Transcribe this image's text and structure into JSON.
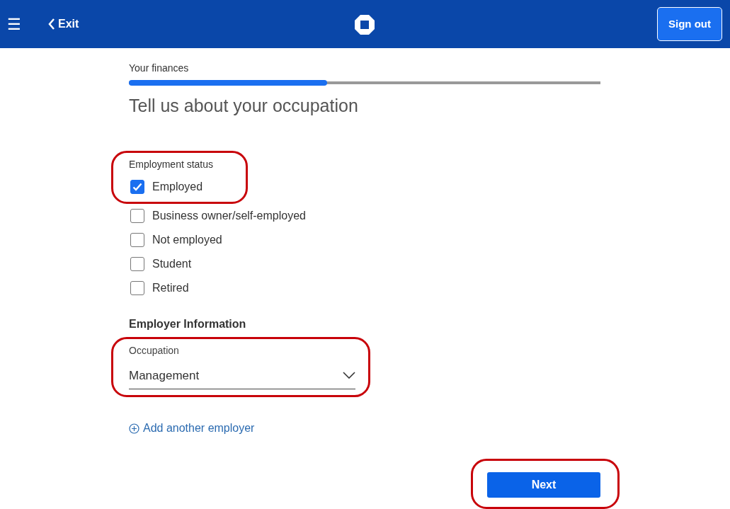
{
  "header": {
    "menu_icon": "☰",
    "exit": "Exit",
    "sign_out": "Sign out"
  },
  "progress": {
    "label": "Your finances",
    "level": 0.42
  },
  "title": "Tell us about your occupation",
  "employment": {
    "label": "Employment status",
    "highlighted": true,
    "options": [
      {
        "label": "Employed",
        "checked": true
      },
      {
        "label": "Business owner/self-employed",
        "checked": false
      },
      {
        "label": "Not employed",
        "checked": false
      },
      {
        "label": "Student",
        "checked": false
      },
      {
        "label": "Retired",
        "checked": false
      }
    ]
  },
  "employer": {
    "heading": "Employer Information",
    "occupation": {
      "label": "Occupation",
      "value": "Management",
      "highlighted": true
    },
    "add_link": "Add another employer"
  },
  "next": {
    "label": "Next",
    "highlighted": true
  }
}
